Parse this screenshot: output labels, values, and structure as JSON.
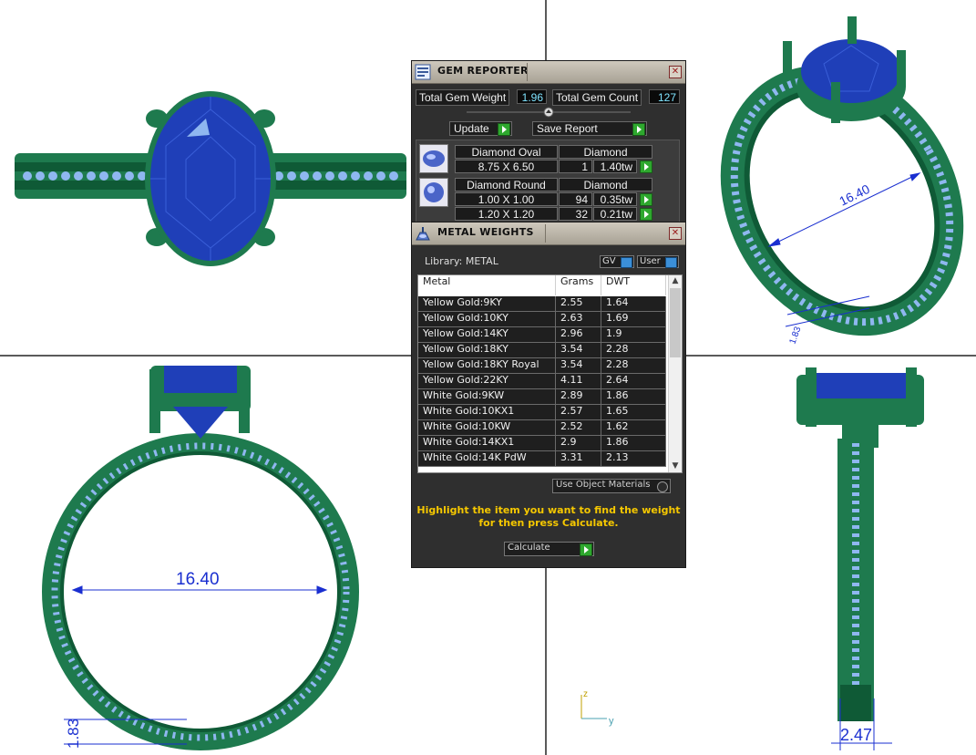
{
  "gem_reporter": {
    "title": "GEM REPORTER",
    "close_glyph": "✕",
    "total_weight_label": "Total Gem Weight",
    "total_weight_value": "1.96",
    "total_count_label": "Total Gem Count",
    "total_count_value": "127",
    "update_label": "Update",
    "save_label": "Save Report",
    "groups": [
      {
        "name": "Diamond Oval",
        "type": "Diamond",
        "rows": [
          {
            "size": "8.75 X 6.50",
            "qty": "1",
            "weight": "1.40tw"
          }
        ]
      },
      {
        "name": "Diamond Round",
        "type": "Diamond",
        "rows": [
          {
            "size": "1.00 X 1.00",
            "qty": "94",
            "weight": "0.35tw"
          },
          {
            "size": "1.20 X 1.20",
            "qty": "32",
            "weight": "0.21tw"
          }
        ]
      }
    ]
  },
  "metal_weights": {
    "title": "METAL WEIGHTS",
    "close_glyph": "✕",
    "library_label": "Library: METAL",
    "gv_label": "GV",
    "user_label": "User",
    "columns": [
      "Metal",
      "Grams",
      "DWT"
    ],
    "rows": [
      [
        "Yellow Gold:9KY",
        "2.55",
        "1.64"
      ],
      [
        "Yellow Gold:10KY",
        "2.63",
        "1.69"
      ],
      [
        "Yellow Gold:14KY",
        "2.96",
        "1.9"
      ],
      [
        "Yellow Gold:18KY",
        "3.54",
        "2.28"
      ],
      [
        "Yellow Gold:18KY Royal",
        "3.54",
        "2.28"
      ],
      [
        "Yellow Gold:22KY",
        "4.11",
        "2.64"
      ],
      [
        "White Gold:9KW",
        "2.89",
        "1.86"
      ],
      [
        "White Gold:10KX1",
        "2.57",
        "1.65"
      ],
      [
        "White Gold:10KW",
        "2.52",
        "1.62"
      ],
      [
        "White Gold:14KX1",
        "2.9",
        "1.86"
      ],
      [
        "White Gold:14K PdW",
        "3.31",
        "2.13"
      ]
    ],
    "use_object_materials_label": "Use Object Materials",
    "hint_line1": "Highlight the item you want to find the weight",
    "hint_line2": "for then press Calculate.",
    "calculate_label": "Calculate"
  },
  "dimensions": {
    "front_inner_diameter": "16.40",
    "perspective_diameter": "16.40",
    "shank_thickness": "1.83",
    "band_width": "2.47",
    "perspective_small": "1.83"
  },
  "axis": {
    "z": "z",
    "y": "y"
  },
  "colors": {
    "metal_green": "#1e7a4e",
    "metal_dark": "#0f5a36",
    "gem_blue": "#1f3fb8",
    "small_gem": "#8fb7f0",
    "dimension_blue": "#1a2fd0",
    "panel_bg": "#2f2f2f",
    "hint_yellow": "#f6c800"
  }
}
